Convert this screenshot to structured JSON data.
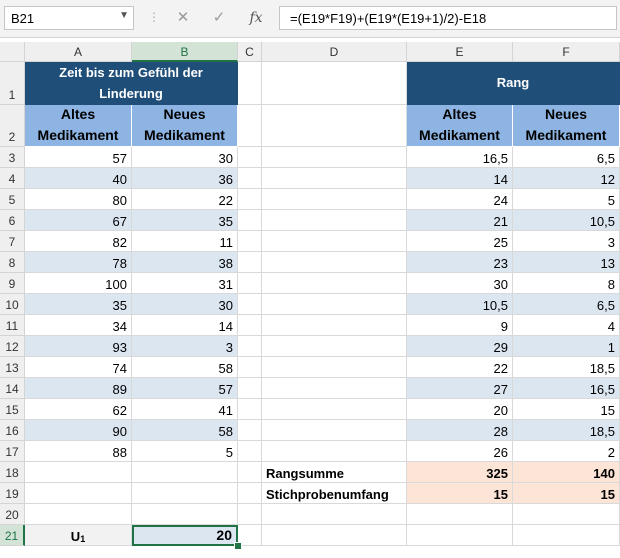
{
  "formula_bar": {
    "name_box": "B21",
    "cancel_icon": "✕",
    "enter_icon": "✓",
    "fx_label": "fx",
    "formula": "=(E19*F19)+(E19*(E19+1)/2)-E18"
  },
  "columns": [
    "A",
    "B",
    "C",
    "D",
    "E",
    "F"
  ],
  "rows": [
    "1",
    "2",
    "3",
    "4",
    "5",
    "6",
    "7",
    "8",
    "9",
    "10",
    "11",
    "12",
    "13",
    "14",
    "15",
    "16",
    "17",
    "18",
    "19",
    "20",
    "21"
  ],
  "table_left": {
    "title": "Zeit bis zum Gefühl der Linderung",
    "col_a": "Altes Medikament",
    "col_b": "Neues Medikament",
    "values_a": [
      "57",
      "40",
      "80",
      "67",
      "82",
      "78",
      "100",
      "35",
      "34",
      "93",
      "74",
      "89",
      "62",
      "90",
      "88"
    ],
    "values_b": [
      "30",
      "36",
      "22",
      "35",
      "11",
      "38",
      "31",
      "30",
      "14",
      "3",
      "58",
      "57",
      "41",
      "58",
      "5"
    ]
  },
  "table_right": {
    "title": "Rang",
    "col_e": "Altes Medikament",
    "col_f": "Neues Medikament",
    "values_e": [
      "16,5",
      "14",
      "24",
      "21",
      "25",
      "23",
      "30",
      "10,5",
      "9",
      "29",
      "22",
      "27",
      "20",
      "28",
      "26"
    ],
    "values_f": [
      "6,5",
      "12",
      "5",
      "10,5",
      "3",
      "13",
      "8",
      "6,5",
      "4",
      "1",
      "18,5",
      "16,5",
      "15",
      "18,5",
      "2"
    ],
    "rangsumme_label": "Rangsumme",
    "rangsumme_e": "325",
    "rangsumme_f": "140",
    "stichprobe_label": "Stichprobenumfang",
    "stichprobe_e": "15",
    "stichprobe_f": "15"
  },
  "u1": {
    "label": "U",
    "label_sub": "1",
    "value": "20"
  }
}
